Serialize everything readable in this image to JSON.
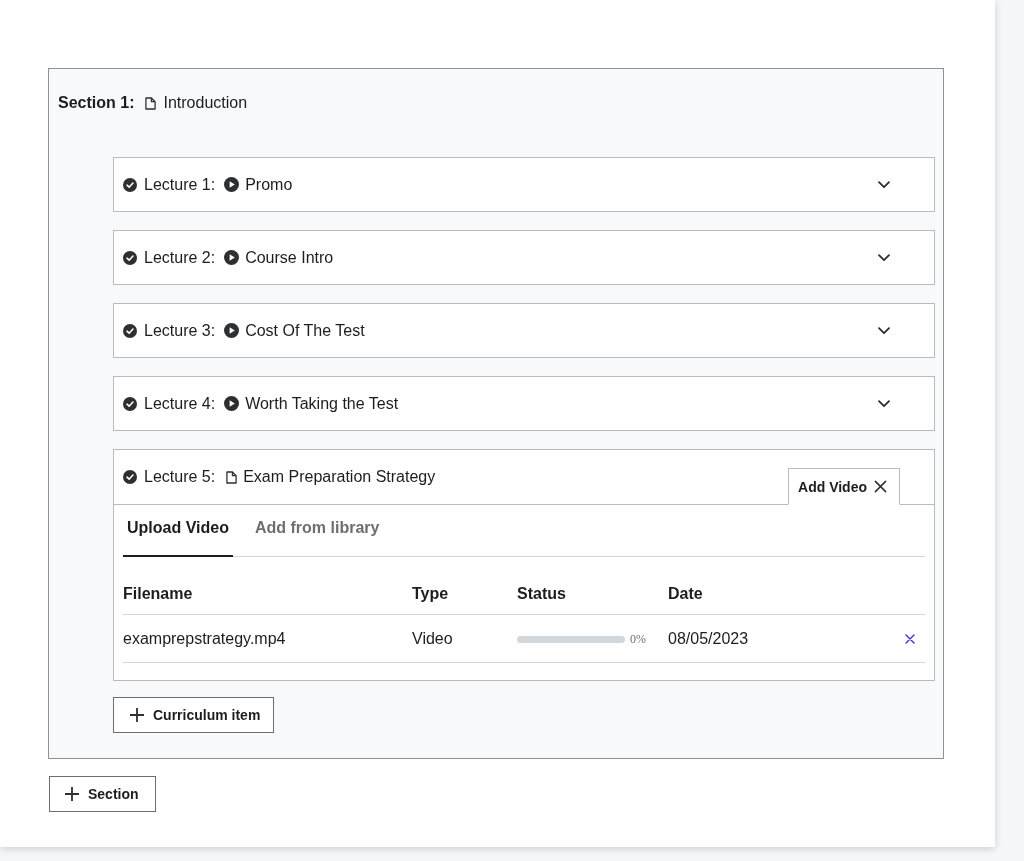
{
  "section": {
    "label": "Section 1:",
    "kind": "article",
    "title": "Introduction"
  },
  "lectures": [
    {
      "label": "Lecture 1:",
      "kind": "video",
      "title": "Promo",
      "completed": true,
      "expanded": false
    },
    {
      "label": "Lecture 2:",
      "kind": "video",
      "title": "Course Intro",
      "completed": true,
      "expanded": false
    },
    {
      "label": "Lecture 3:",
      "kind": "video",
      "title": "Cost Of The Test",
      "completed": true,
      "expanded": false
    },
    {
      "label": "Lecture 4:",
      "kind": "video",
      "title": "Worth Taking the Test",
      "completed": true,
      "expanded": false
    },
    {
      "label": "Lecture 5:",
      "kind": "article",
      "title": "Exam Preparation Strategy",
      "completed": true,
      "expanded": true,
      "editor": {
        "title": "Add Video",
        "tabs": [
          {
            "label": "Upload Video",
            "selected": true
          },
          {
            "label": "Add from library",
            "selected": false
          }
        ],
        "table": {
          "columns": [
            "Filename",
            "Type",
            "Status",
            "Date"
          ],
          "rows": [
            {
              "filename": "examprepstrategy.mp4",
              "type": "Video",
              "progress": "0%",
              "date": "08/05/2023"
            }
          ]
        }
      }
    }
  ],
  "add_item_button": "Curriculum item",
  "add_section_button": "Section"
}
